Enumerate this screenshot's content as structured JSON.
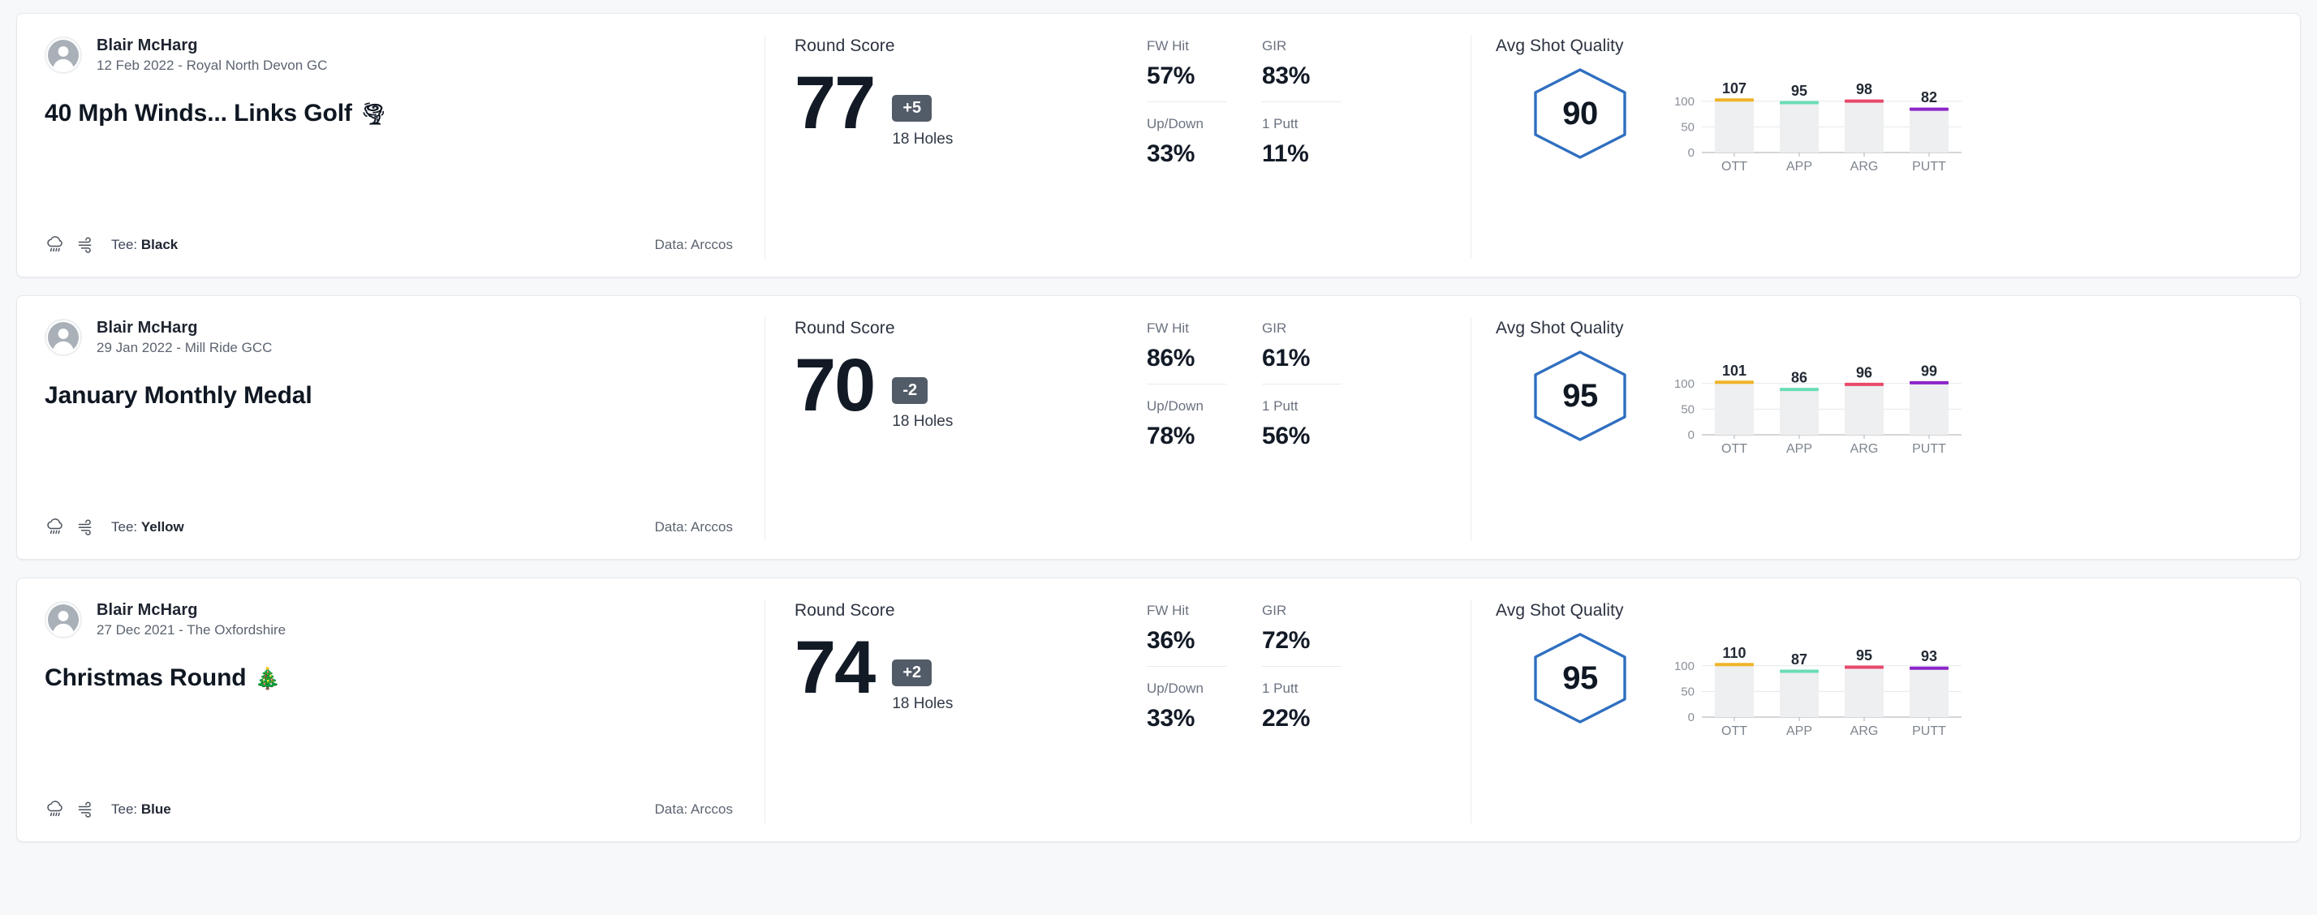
{
  "labels": {
    "round_score": "Round Score",
    "holes": "18 Holes",
    "avg_shot_quality": "Avg Shot Quality",
    "fw_hit": "FW Hit",
    "gir": "GIR",
    "up_down": "Up/Down",
    "one_putt": "1 Putt",
    "tee_prefix": "Tee: ",
    "data_prefix": "Data: "
  },
  "colors": {
    "hexagon": "#2f6fc0",
    "bar_ott": "#f0b429",
    "bar_app": "#6bdcb4",
    "bar_arg": "#e8496b",
    "bar_putt": "#8b25c9",
    "badge_bg": "#525b68",
    "score_text": "#121a26"
  },
  "rounds": [
    {
      "player": "Blair McHarg",
      "date_course": "12 Feb 2022 - Royal North Devon GC",
      "title": "40 Mph Winds... Links Golf",
      "title_emoji": "🌪",
      "tee": "Black",
      "data_source": "Arccos",
      "score": "77",
      "to_par": "+5",
      "holes": "18 Holes",
      "stats": {
        "fw_hit": "57%",
        "gir": "83%",
        "up_down": "33%",
        "one_putt": "11%"
      },
      "shot_quality": "90",
      "chart_data": {
        "type": "bar",
        "title": "Avg Shot Quality",
        "categories": [
          "OTT",
          "APP",
          "ARG",
          "PUTT"
        ],
        "values": [
          107,
          95,
          98,
          82
        ],
        "colors": [
          "#f0b429",
          "#6bdcb4",
          "#e8496b",
          "#8b25c9"
        ],
        "yticks": [
          0,
          50,
          100
        ],
        "ylim": [
          0,
          125
        ],
        "xlabel": "",
        "ylabel": "",
        "grid": true,
        "legend": "none"
      }
    },
    {
      "player": "Blair McHarg",
      "date_course": "29 Jan 2022 - Mill Ride GCC",
      "title": "January Monthly Medal",
      "title_emoji": "",
      "tee": "Yellow",
      "data_source": "Arccos",
      "score": "70",
      "to_par": "-2",
      "holes": "18 Holes",
      "stats": {
        "fw_hit": "86%",
        "gir": "61%",
        "up_down": "78%",
        "one_putt": "56%"
      },
      "shot_quality": "95",
      "chart_data": {
        "type": "bar",
        "title": "Avg Shot Quality",
        "categories": [
          "OTT",
          "APP",
          "ARG",
          "PUTT"
        ],
        "values": [
          101,
          86,
          96,
          99
        ],
        "colors": [
          "#f0b429",
          "#6bdcb4",
          "#e8496b",
          "#8b25c9"
        ],
        "yticks": [
          0,
          50,
          100
        ],
        "ylim": [
          0,
          125
        ],
        "xlabel": "",
        "ylabel": "",
        "grid": true,
        "legend": "none"
      }
    },
    {
      "player": "Blair McHarg",
      "date_course": "27 Dec 2021 - The Oxfordshire",
      "title": "Christmas Round",
      "title_emoji": "🎄",
      "tee": "Blue",
      "data_source": "Arccos",
      "score": "74",
      "to_par": "+2",
      "holes": "18 Holes",
      "stats": {
        "fw_hit": "36%",
        "gir": "72%",
        "up_down": "33%",
        "one_putt": "22%"
      },
      "shot_quality": "95",
      "chart_data": {
        "type": "bar",
        "title": "Avg Shot Quality",
        "categories": [
          "OTT",
          "APP",
          "ARG",
          "PUTT"
        ],
        "values": [
          110,
          87,
          95,
          93
        ],
        "colors": [
          "#f0b429",
          "#6bdcb4",
          "#e8496b",
          "#8b25c9"
        ],
        "yticks": [
          0,
          50,
          100
        ],
        "ylim": [
          0,
          125
        ],
        "xlabel": "",
        "ylabel": "",
        "grid": true,
        "legend": "none"
      }
    }
  ]
}
